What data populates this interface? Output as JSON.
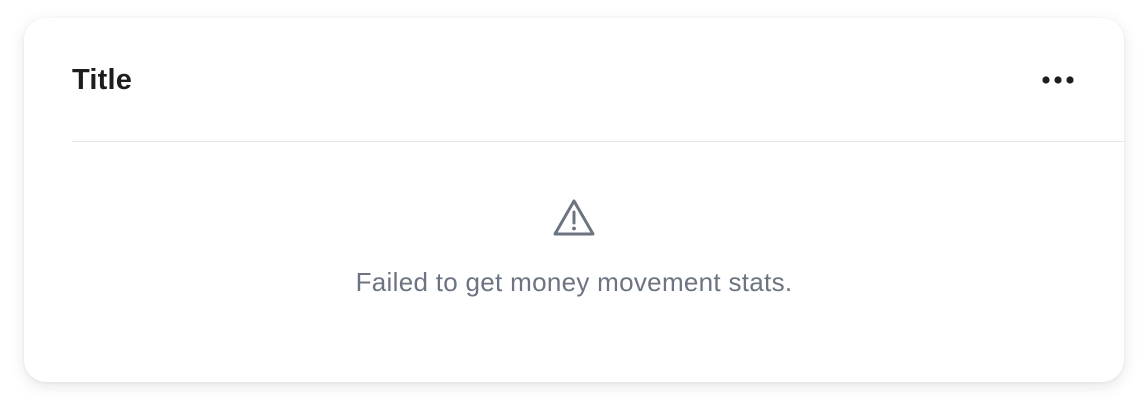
{
  "card": {
    "title": "Title",
    "menu_icon": "more-horizontal-icon",
    "error": {
      "icon": "warning-triangle-icon",
      "message": "Failed to get money movement stats."
    }
  },
  "colors": {
    "title": "#1d1d1f",
    "message": "#6b7480",
    "icon": "#6b7480",
    "divider": "#e3e5e8"
  }
}
